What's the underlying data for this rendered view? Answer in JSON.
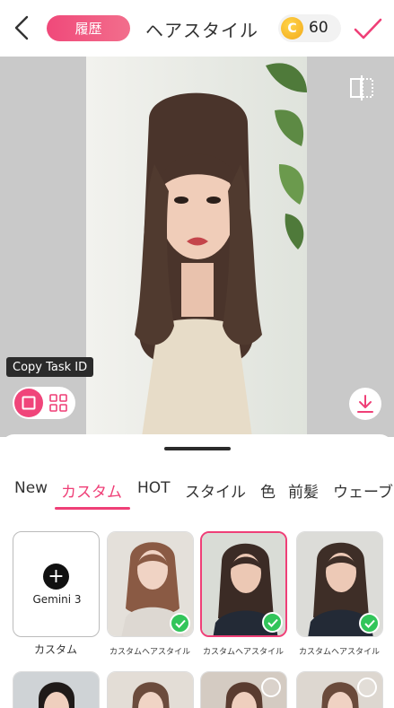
{
  "header": {
    "history_label": "履歴",
    "title": "ヘアスタイル",
    "coin_symbol": "C",
    "coin_count": "60",
    "accent_color": "#ef3f77"
  },
  "preview": {
    "copy_task_label": "Copy Task ID"
  },
  "tabs": [
    {
      "label": "New"
    },
    {
      "label": "カスタム",
      "active": true
    },
    {
      "label": "HOT"
    },
    {
      "label": "スタイル"
    },
    {
      "label": "色"
    },
    {
      "label": "前髪"
    },
    {
      "label": "ウェーブ"
    }
  ],
  "cards": [
    {
      "title": "Gemini 3",
      "label": "カスタム"
    },
    {
      "label": "カスタムヘアスタイル",
      "checked": true
    },
    {
      "label": "カスタムヘアスタイル",
      "checked": true,
      "selected": true
    },
    {
      "label": "カスタムヘアスタイル",
      "checked": true
    }
  ]
}
